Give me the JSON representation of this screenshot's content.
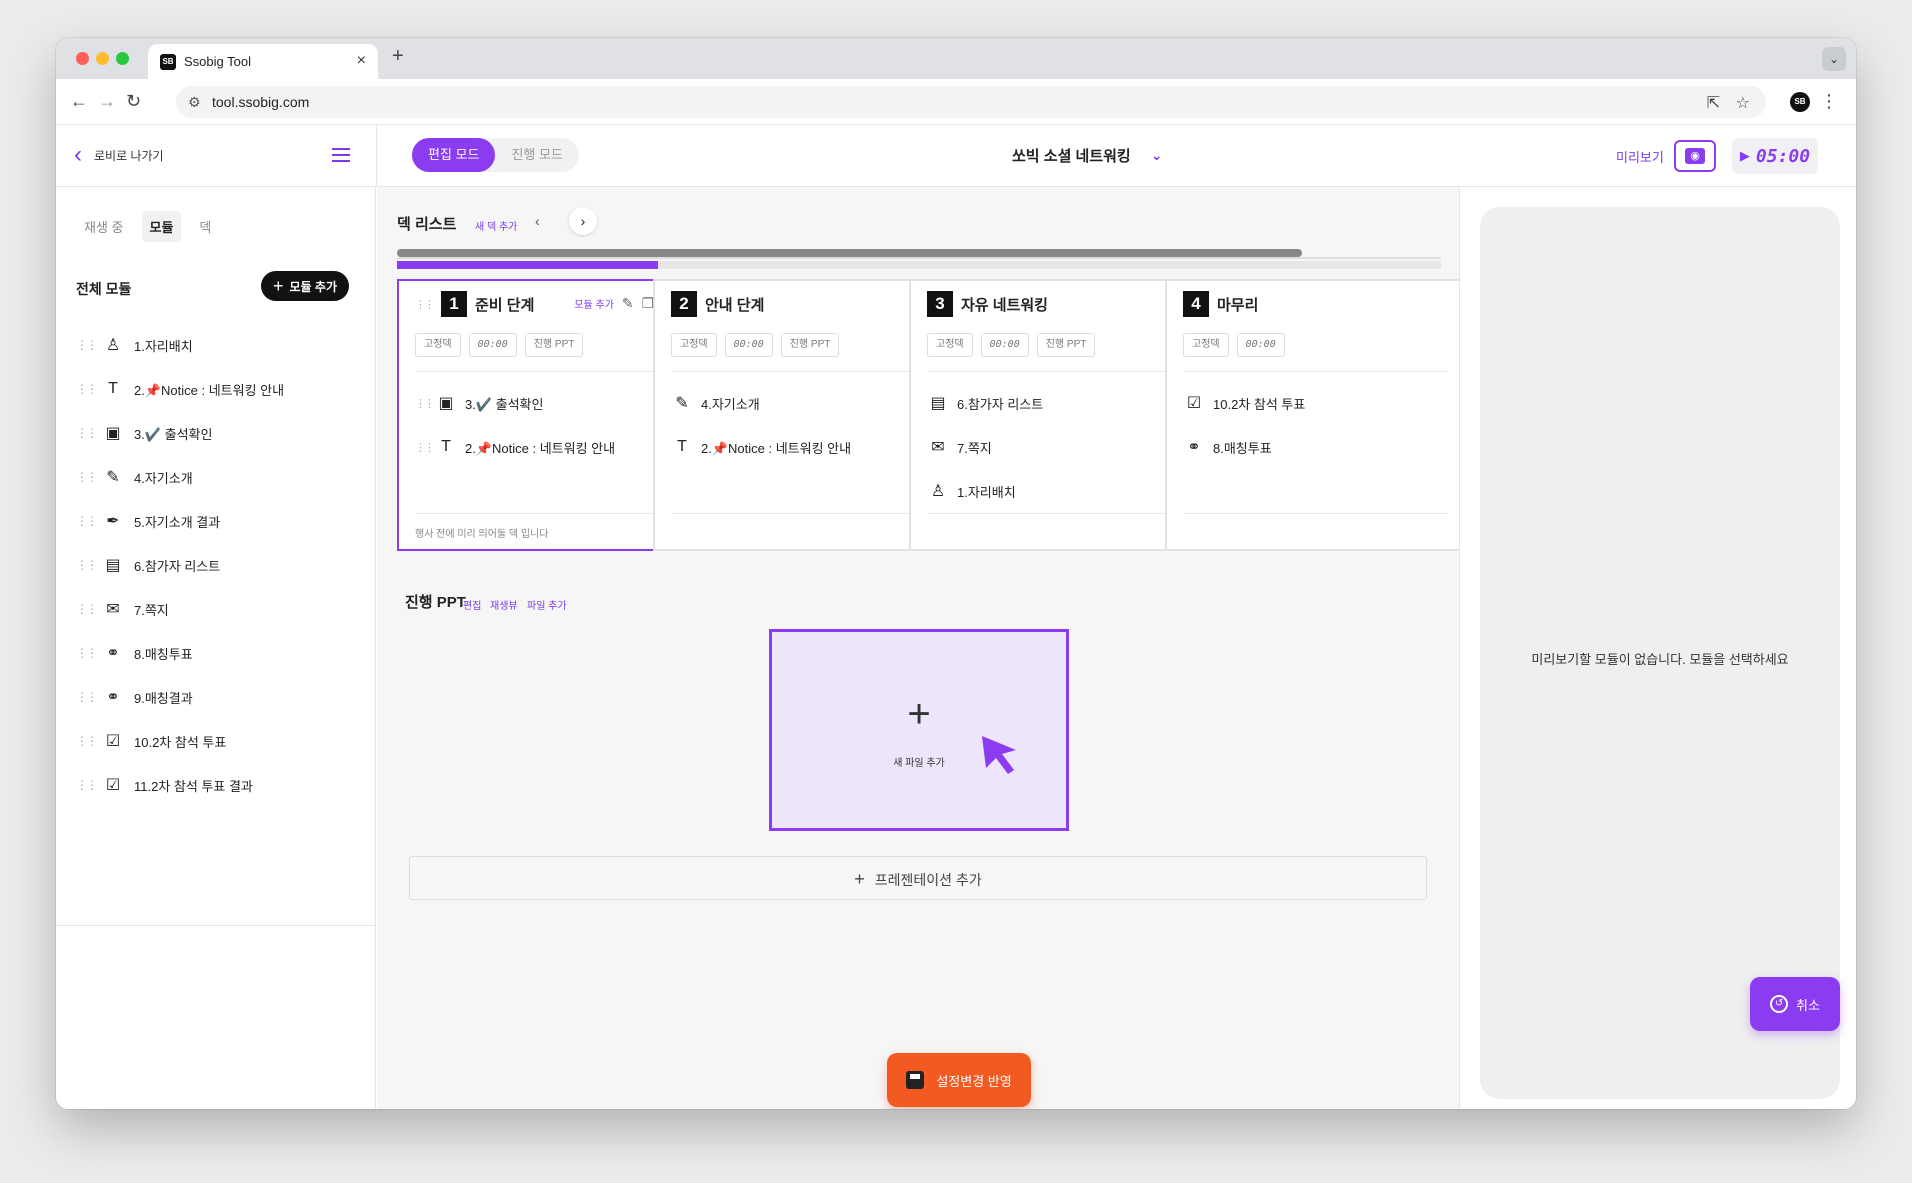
{
  "browser": {
    "tab_title": "Ssobig Tool",
    "tab_favicon": "SB",
    "new_tab": "+",
    "url": "tool.ssobig.com"
  },
  "header": {
    "back_label": "로비로 나가기",
    "modes": [
      "편집 모드",
      "진행 모드"
    ],
    "deck_title": "쏘빅 소셜 네트워킹",
    "preview_label": "미리보기",
    "timer": "05:00"
  },
  "sidebar": {
    "tabs": [
      "재생 중",
      "모듈",
      "덱"
    ],
    "section_title": "전체 모듈",
    "add_module_label": "모듈 추가",
    "modules": [
      {
        "icon": "seat-icon",
        "glyph": "♙",
        "label": "1.자리배치"
      },
      {
        "icon": "text-icon",
        "glyph": "T",
        "label": "2.📌Notice : 네트워킹 안내"
      },
      {
        "icon": "qr-icon",
        "glyph": "▣",
        "label": "3.✔️ 출석확인"
      },
      {
        "icon": "pencil-icon",
        "glyph": "✎",
        "label": "4.자기소개"
      },
      {
        "icon": "pen-icon",
        "glyph": "✒",
        "label": "5.자기소개 결과"
      },
      {
        "icon": "id-card-icon",
        "glyph": "▤",
        "label": "6.참가자 리스트"
      },
      {
        "icon": "mail-icon",
        "glyph": "✉",
        "label": "7.쪽지"
      },
      {
        "icon": "match-icon",
        "glyph": "⚭",
        "label": "8.매칭투표"
      },
      {
        "icon": "match-result-icon",
        "glyph": "⚭",
        "label": "9.매칭결과"
      },
      {
        "icon": "checkbox-icon",
        "glyph": "☑",
        "label": "10.2차 참석 투표"
      },
      {
        "icon": "checkbox-filled-icon",
        "glyph": "☑",
        "label": "11.2차 참석 투표 결과"
      }
    ]
  },
  "deck_list": {
    "title": "덱 리스트",
    "new_deck": "새 덱 추가",
    "progress": 0.25,
    "cards": [
      {
        "num": "1",
        "title": "준비 단계",
        "add_label": "모듈 추가",
        "chips": [
          "고정덱",
          "00:00",
          "진행 PPT"
        ],
        "items": [
          {
            "icon": "qr-icon",
            "glyph": "▣",
            "label": "3.✔️ 출석확인"
          },
          {
            "icon": "text-icon",
            "glyph": "T",
            "label": "2.📌Notice : 네트워킹 안내"
          }
        ],
        "footer": "행사 전에 미리 띄어둘 덱 입니다"
      },
      {
        "num": "2",
        "title": "안내 단계",
        "chips": [
          "고정덱",
          "00:00",
          "진행 PPT"
        ],
        "items": [
          {
            "icon": "pencil-icon",
            "glyph": "✎",
            "label": "4.자기소개"
          },
          {
            "icon": "text-icon",
            "glyph": "T",
            "label": "2.📌Notice : 네트워킹 안내"
          }
        ]
      },
      {
        "num": "3",
        "title": "자유 네트워킹",
        "chips": [
          "고정덱",
          "00:00",
          "진행 PPT"
        ],
        "items": [
          {
            "icon": "id-card-icon",
            "glyph": "▤",
            "label": "6.참가자 리스트"
          },
          {
            "icon": "mail-icon",
            "glyph": "✉",
            "label": "7.쪽지"
          },
          {
            "icon": "seat-icon",
            "glyph": "♙",
            "label": "1.자리배치"
          }
        ]
      },
      {
        "num": "4",
        "title": "마무리",
        "chips": [
          "고정덱",
          "00:00"
        ],
        "items": [
          {
            "icon": "checkbox-icon",
            "glyph": "☑",
            "label": "10.2차 참석 투표"
          },
          {
            "icon": "match-icon",
            "glyph": "⚭",
            "label": "8.매칭투표"
          }
        ]
      }
    ]
  },
  "ppt": {
    "title": "진행 PPT",
    "links": [
      "편집",
      "재생뷰",
      "파일 추가"
    ],
    "dropzone_label": "새 파일 추가",
    "add_presentation": "프레젠테이션 추가"
  },
  "save_label": "설정변경 반영",
  "preview": {
    "empty_text": "미리보기할 모듈이 없습니다. 모듈을 선택하세요",
    "cancel_label": "취소"
  },
  "colors": {
    "accent": "#8b3cf0",
    "save": "#f25a22"
  }
}
